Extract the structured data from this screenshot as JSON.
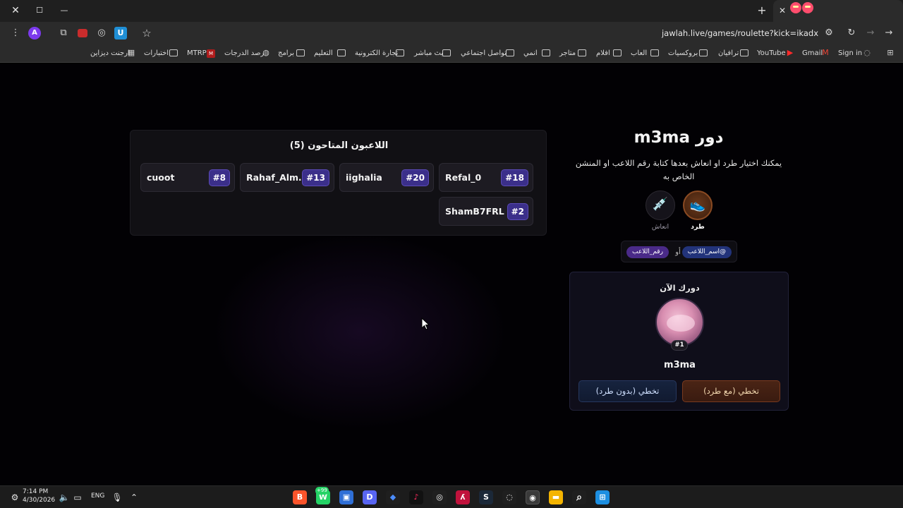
{
  "browser": {
    "window_controls": {
      "close": "✕",
      "maximize": "☐",
      "minimize": "—"
    },
    "new_tab": "+",
    "tab_close": "✕",
    "url": "jawlah.live/games/roulette?kick=ikadx",
    "profile_letter": "A",
    "extension_u": "U"
  },
  "bookmarks": [
    {
      "label": "Sign in",
      "icon": "globe-icon"
    },
    {
      "label": "Gmail",
      "icon": "gmail-icon"
    },
    {
      "label": "YouTube",
      "icon": "youtube-icon"
    },
    {
      "label": "ترافيان",
      "icon": "folder-icon"
    },
    {
      "label": "بروكسيات",
      "icon": "folder-icon"
    },
    {
      "label": "العاب",
      "icon": "folder-icon"
    },
    {
      "label": "افلام",
      "icon": "folder-icon"
    },
    {
      "label": "متاجر",
      "icon": "folder-icon"
    },
    {
      "label": "انمي",
      "icon": "folder-icon"
    },
    {
      "label": "تواصل اجتماعي",
      "icon": "folder-icon"
    },
    {
      "label": "بث مباشر",
      "icon": "folder-icon"
    },
    {
      "label": "تجارة الكترونية",
      "icon": "folder-icon"
    },
    {
      "label": "التعليم",
      "icon": "folder-icon"
    },
    {
      "label": "برامج",
      "icon": "folder-icon"
    },
    {
      "label": "رصد الدرجات",
      "icon": "globe-icon"
    },
    {
      "label": "MTRP",
      "icon": "mtrp-icon"
    },
    {
      "label": "اختبارات",
      "icon": "folder-icon"
    },
    {
      "label": "ارجنت ديزاين",
      "icon": "image-icon"
    }
  ],
  "players_panel": {
    "title": "اللاعبون المتاحون (5)",
    "players": [
      {
        "name": "Refal_0",
        "number": "#18"
      },
      {
        "name": "iighalia",
        "number": "#20"
      },
      {
        "name": "Rahaf_Almu...",
        "number": "#13"
      },
      {
        "name": "cuoot",
        "number": "#8"
      },
      {
        "name": "ShamB7FRL",
        "number": "#2"
      }
    ]
  },
  "turn": {
    "title": "دور m3ma",
    "description": "يمكنك اختيار طرد او انعاش بعدها كتابة رقم اللاعب او المنشن الخاص به",
    "actions": {
      "kick_label": "طرد",
      "revive_label": "انعاش"
    },
    "hint": {
      "mention_pill": "@اسم_اللاعب",
      "or": "أو",
      "number_pill": "رقم_اللاعب"
    }
  },
  "now_card": {
    "title": "دورك الآن",
    "badge": "#1",
    "name": "m3ma",
    "skip_with_kick": "تخطي (مع طرد)",
    "skip_without_kick": "تخطي (بدون طرد)"
  },
  "taskbar": {
    "time": "7:14 PM",
    "date": "4/30/2026",
    "lang": "ENG",
    "whatsapp_badge": "+99"
  },
  "colors": {
    "accent_purple": "#3b2f8a",
    "kick_orange": "#7a3a1e",
    "page_bg": "#020104"
  }
}
